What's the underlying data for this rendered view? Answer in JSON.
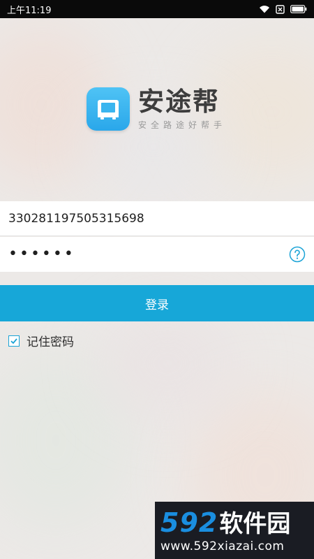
{
  "status_bar": {
    "time": "上午11:19",
    "icons": [
      "wifi-icon",
      "no-sim-icon",
      "battery-icon"
    ]
  },
  "logo": {
    "icon": "bus-icon",
    "app_name": "安途帮",
    "slogan": "安全路途好帮手"
  },
  "form": {
    "username_value": "330281197505315698",
    "password_masked": "••••••",
    "help_icon": "question-circle-icon"
  },
  "login_button": {
    "label": "登录"
  },
  "remember": {
    "label": "记住密码",
    "checked": true
  },
  "watermark": {
    "brand_number": "592",
    "brand_name": "软件园",
    "url": "www.592xiazai.com"
  },
  "colors": {
    "accent": "#17a7d8",
    "icon_gradient_top": "#4fc3f5",
    "status_bar": "#0a0a0a",
    "watermark_blue": "#1a8ee0"
  }
}
